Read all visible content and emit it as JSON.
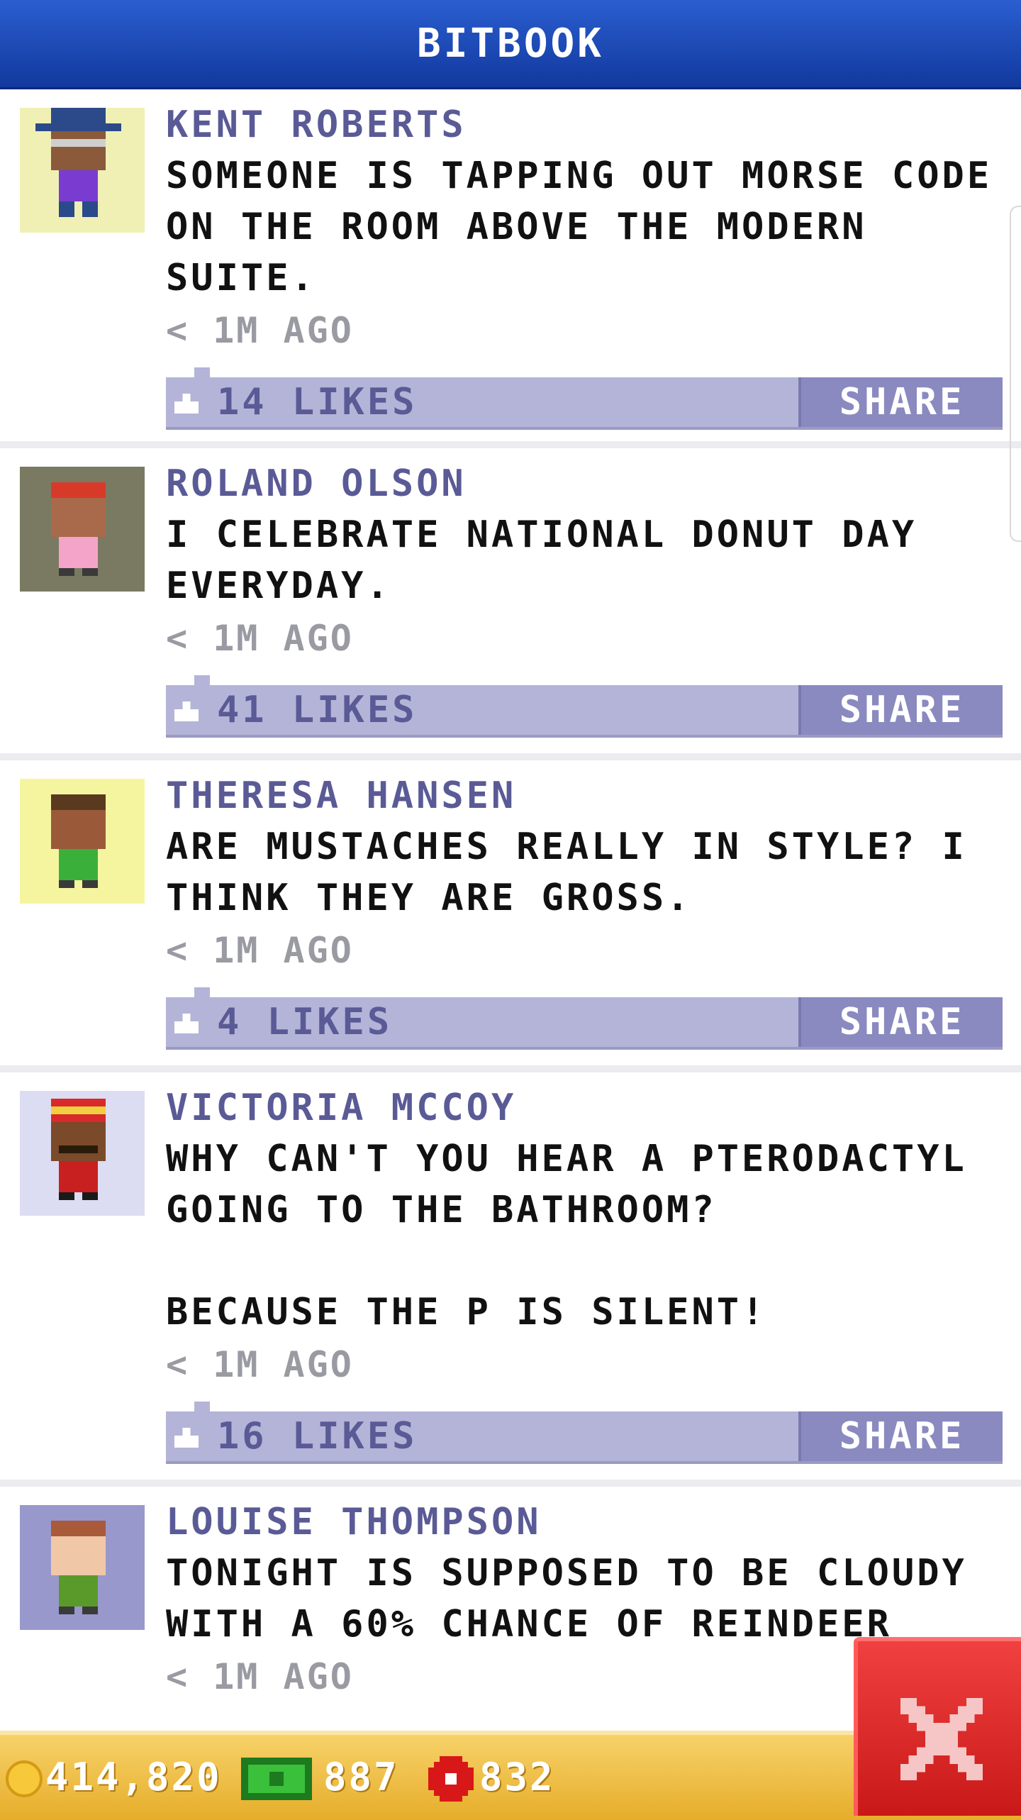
{
  "header": {
    "title": "BITBOOK"
  },
  "posts": [
    {
      "author": "KENT ROBERTS",
      "text": "SOMEONE IS TAPPING OUT MORSE CODE\nON THE ROOM ABOVE THE MODERN\nSUITE.",
      "time": "< 1M AGO",
      "likes": "14 LIKES",
      "share": "SHARE",
      "avatar_bg": "#f0f0b4"
    },
    {
      "author": "ROLAND OLSON",
      "text": "I CELEBRATE NATIONAL DONUT DAY\nEVERYDAY.",
      "time": "< 1M AGO",
      "likes": "41 LIKES",
      "share": "SHARE",
      "avatar_bg": "#7a7a62"
    },
    {
      "author": "THERESA HANSEN",
      "text": "ARE MUSTACHES REALLY IN STYLE? I\nTHINK THEY ARE GROSS.",
      "time": "< 1M AGO",
      "likes": "4 LIKES",
      "share": "SHARE",
      "avatar_bg": "#f5f5a0"
    },
    {
      "author": "VICTORIA MCCOY",
      "text": "WHY CAN'T YOU HEAR A PTERODACTYL\nGOING TO THE BATHROOM?\n\nBECAUSE THE P IS SILENT!",
      "time": "< 1M AGO",
      "likes": "16 LIKES",
      "share": "SHARE",
      "avatar_bg": "#dcdcf2"
    },
    {
      "author": "LOUISE THOMPSON",
      "text": "TONIGHT IS SUPPOSED TO BE CLOUDY\nWITH A 60% CHANCE OF REINDEER",
      "time": "< 1M AGO",
      "avatar_bg": "#9898cc"
    }
  ],
  "footer": {
    "coins": "414,820",
    "bux": "887",
    "chips": "832"
  },
  "icons": [
    "avatar-icon",
    "thumbs-up-icon",
    "coin-icon",
    "cash-icon",
    "chip-icon",
    "close-icon"
  ]
}
